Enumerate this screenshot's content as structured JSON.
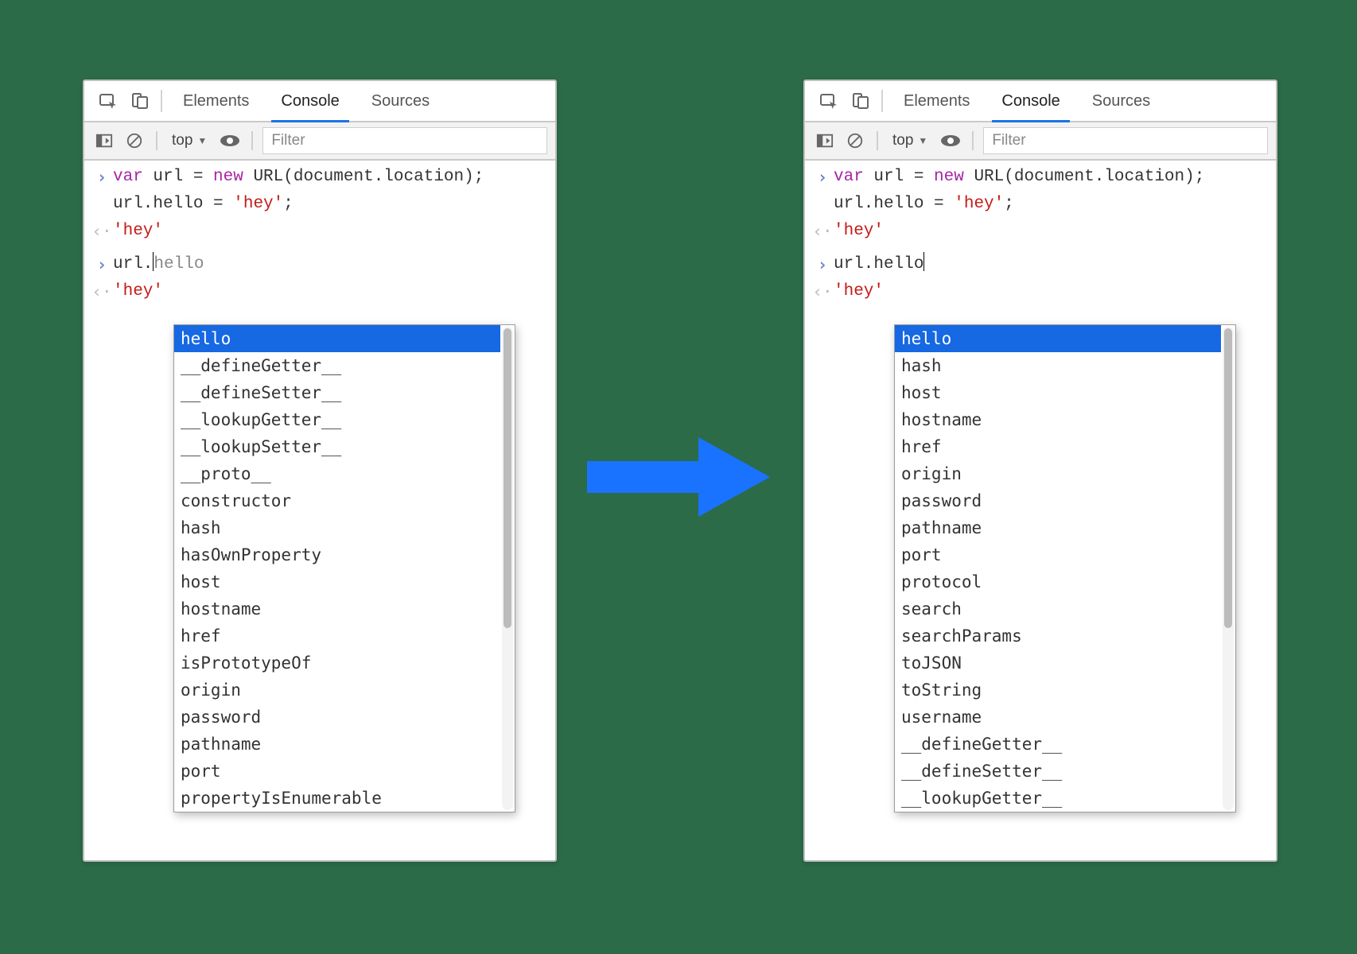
{
  "tabs": {
    "elements": "Elements",
    "console": "Console",
    "sources": "Sources"
  },
  "toolbar": {
    "context": "top",
    "filter_placeholder": "Filter"
  },
  "input_code": {
    "line1_var": "var",
    "line1_mid": " url = ",
    "line1_new": "new",
    "line1_sp": " ",
    "line1_fn": "URL",
    "line1_paren_open": "(",
    "line1_doc": "document",
    "line1_rest": ".location);",
    "line2": "url.hello = ",
    "line2_str": "'hey'",
    "line2_semi": ";"
  },
  "output1": "'hey'",
  "prompt2_prefix": "url.",
  "prompt2_hint_left": "hello",
  "prompt2_value_right": "hello",
  "output2": "'hey'",
  "ac_selected": "hello",
  "ac_left": [
    "__defineGetter__",
    "__defineSetter__",
    "__lookupGetter__",
    "__lookupSetter__",
    "__proto__",
    "constructor",
    "hash",
    "hasOwnProperty",
    "host",
    "hostname",
    "href",
    "isPrototypeOf",
    "origin",
    "password",
    "pathname",
    "port",
    "propertyIsEnumerable"
  ],
  "ac_right": [
    "hash",
    "host",
    "hostname",
    "href",
    "origin",
    "password",
    "pathname",
    "port",
    "protocol",
    "search",
    "searchParams",
    "toJSON",
    "toString",
    "username",
    "__defineGetter__",
    "__defineSetter__",
    "__lookupGetter__"
  ]
}
